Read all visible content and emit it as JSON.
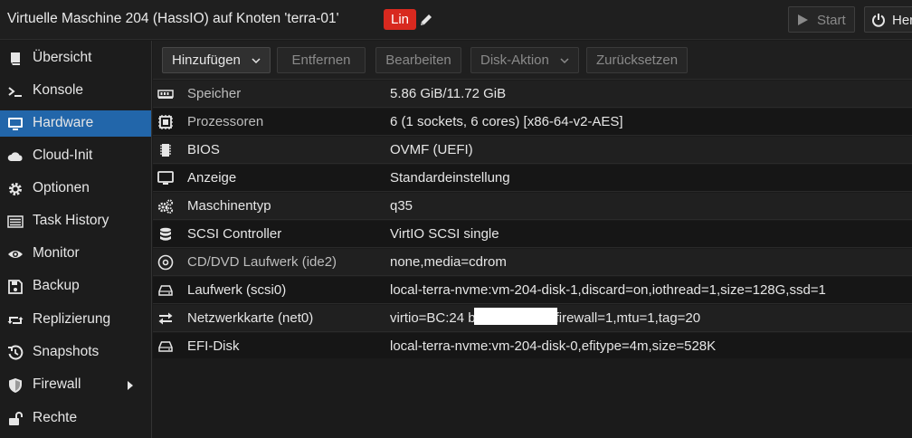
{
  "header": {
    "title": "Virtuelle Maschine 204 (HassIO) auf Knoten 'terra-01'",
    "tag": "Lin",
    "start_label": "Start",
    "power_label": "Herunterfahren"
  },
  "sidebar": {
    "items": [
      {
        "label": "Übersicht",
        "icon": "book-icon"
      },
      {
        "label": "Konsole",
        "icon": "terminal-icon"
      },
      {
        "label": "Hardware",
        "icon": "desktop-icon",
        "active": true
      },
      {
        "label": "Cloud-Init",
        "icon": "cloud-icon"
      },
      {
        "label": "Optionen",
        "icon": "gear-icon"
      },
      {
        "label": "Task History",
        "icon": "list-icon"
      },
      {
        "label": "Monitor",
        "icon": "eye-icon"
      },
      {
        "label": "Backup",
        "icon": "floppy-icon"
      },
      {
        "label": "Replizierung",
        "icon": "retweet-icon"
      },
      {
        "label": "Snapshots",
        "icon": "history-icon"
      },
      {
        "label": "Firewall",
        "icon": "shield-icon"
      },
      {
        "label": "Rechte",
        "icon": "unlock-icon"
      }
    ]
  },
  "toolbar": {
    "add_label": "Hinzufügen",
    "remove_label": "Entfernen",
    "edit_label": "Bearbeiten",
    "disk_action_label": "Disk-Aktion",
    "reset_label": "Zurücksetzen"
  },
  "hardware": {
    "rows": [
      {
        "name": "Speicher",
        "value": "5.86 GiB/11.72 GiB",
        "icon": "memory-icon"
      },
      {
        "name": "Prozessoren",
        "value": "6 (1 sockets, 6 cores) [x86-64-v2-AES]",
        "icon": "cpu-icon"
      },
      {
        "name": "BIOS",
        "value": "OVMF (UEFI)",
        "icon": "microchip-icon"
      },
      {
        "name": "Anzeige",
        "value": "Standardeinstellung",
        "icon": "monitor-icon"
      },
      {
        "name": "Maschinentyp",
        "value": "q35",
        "icon": "cogs-icon"
      },
      {
        "name": "SCSI Controller",
        "value": "VirtIO SCSI single",
        "icon": "database-icon"
      },
      {
        "name": "CD/DVD Laufwerk (ide2)",
        "value": "none,media=cdrom",
        "icon": "cdrom-icon"
      },
      {
        "name": "Laufwerk (scsi0)",
        "value": "local-terra-nvme:vm-204-disk-1,discard=on,iothread=1,size=128G,ssd=1",
        "icon": "hdd-icon"
      },
      {
        "name": "Netzwerkkarte (net0)",
        "value": "virtio=BC:24                      bridge=vmbr0,firewall=1,mtu=1,tag=20",
        "icon": "exchange-icon"
      },
      {
        "name": "EFI-Disk",
        "value": "local-terra-nvme:vm-204-disk-0,efitype=4m,size=528K",
        "icon": "hdd-icon"
      }
    ]
  }
}
